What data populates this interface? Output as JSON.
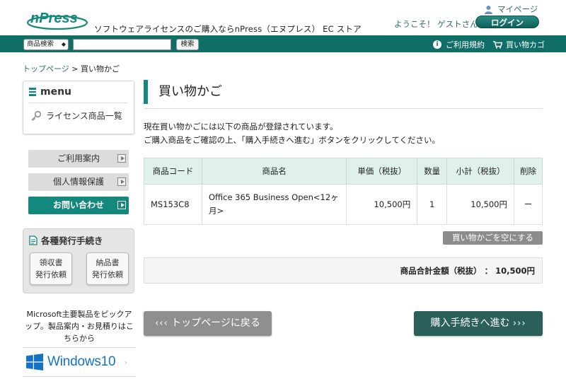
{
  "header": {
    "logo_text": "nPress",
    "tagline": "ソフトウェアライセンスのご購入ならnPress（エヌプレス） EC ストア",
    "mypage": "マイページ",
    "welcome": "ようこそ！ ゲストさん",
    "login": "ログイン"
  },
  "nav": {
    "search_select": "商品検索",
    "search_input_value": "",
    "search_button": "検索",
    "terms": "ご利用規約",
    "cart": "買い物カゴ"
  },
  "breadcrumb": {
    "home": "トップページ",
    "separator": " > ",
    "current": "買い物かご"
  },
  "sidebar": {
    "menu_title": "menu",
    "menu_items": [
      {
        "label": "ライセンス商品一覧"
      }
    ],
    "buttons": [
      {
        "label": "ご利用案内"
      },
      {
        "label": "個人情報保護"
      },
      {
        "label": "お問い合わせ"
      }
    ],
    "docs_title": "各種発行手続き",
    "docs_buttons": [
      {
        "line1": "領収書",
        "line2": "発行依頼"
      },
      {
        "line1": "納品書",
        "line2": "発行依頼"
      }
    ],
    "promo_text": "Microsoft主要製品をピックアップ。製品案内・お見積りはこちらから",
    "banner_text": "Windows10"
  },
  "main": {
    "title": "買い物かご",
    "intro_line1": "現在買い物かごには以下の商品が登録されています。",
    "intro_line2": "ご購入商品をご確認の上、「購入手続きへ進む」ボタンをクリックしてください。",
    "table": {
      "headers": [
        "商品コード",
        "商品名",
        "単価（税抜）",
        "数量",
        "小計（税抜）",
        "削除"
      ],
      "rows": [
        {
          "code": "MS153C8",
          "name": "Office 365 Business Open<12ヶ月>",
          "unit_price": "10,500円",
          "qty": "1",
          "subtotal": "10,500円",
          "delete": "ー"
        }
      ]
    },
    "clear_button": "買い物かごを空にする",
    "total_label": "商品合計金額（税抜）",
    "total_separator": "：",
    "total_value": "10,500円",
    "back_button": "トップページに戻る",
    "proceed_button": "購入手続きへ進む"
  },
  "colors": {
    "brand_teal": "#13887d",
    "nav_teal": "#0f6e66",
    "dark_teal_button": "#2a5f5a",
    "table_header_bg": "#dff0ed"
  }
}
